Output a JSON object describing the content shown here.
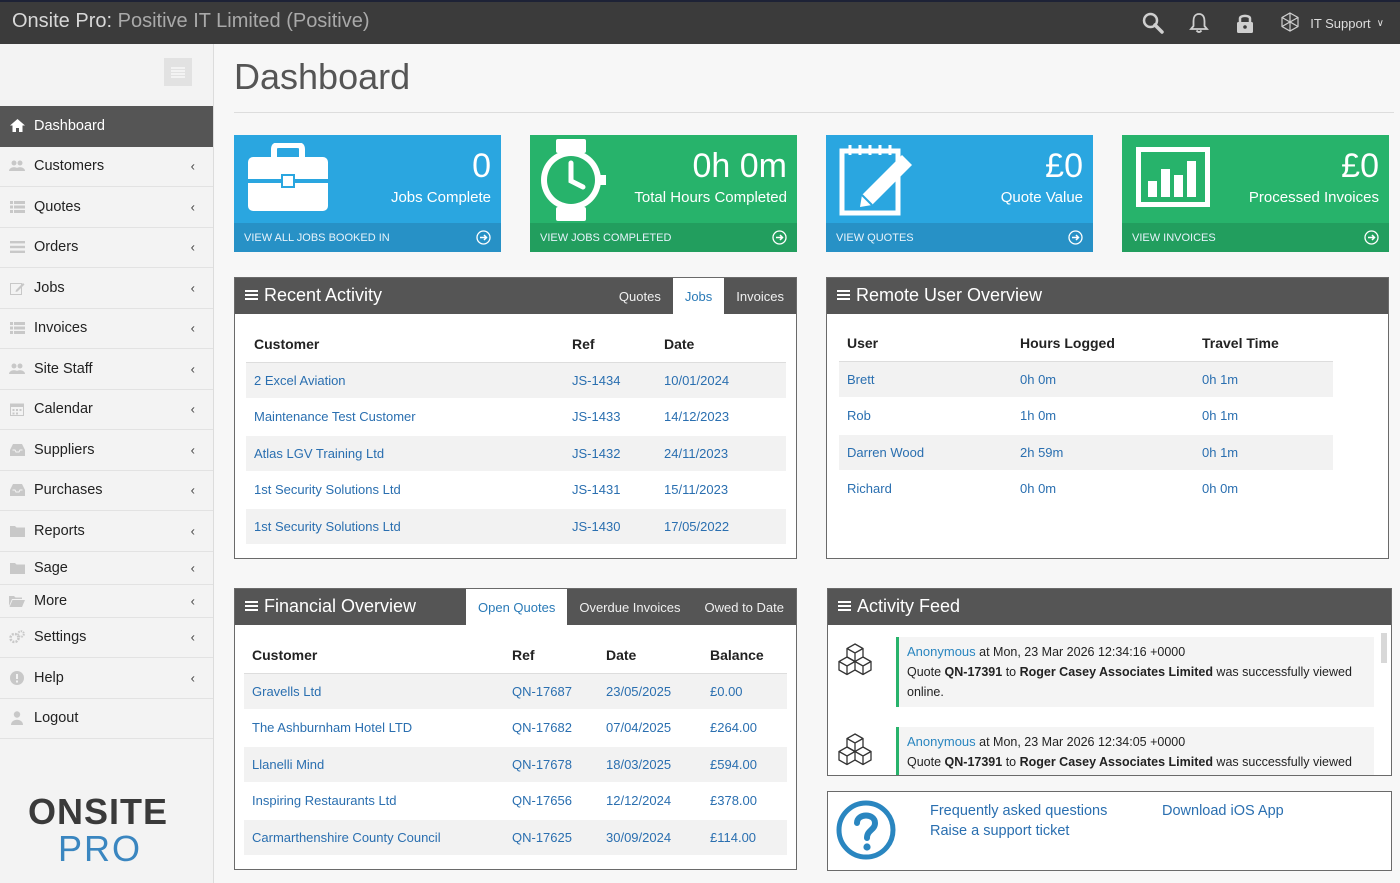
{
  "header": {
    "app_name": "Onsite Pro:",
    "company": " Positive IT Limited (Positive)",
    "user_label": "IT Support",
    "icons": [
      "search-icon",
      "bell-icon",
      "lock-icon",
      "user-avatar-icon"
    ]
  },
  "sidebar": {
    "items": [
      {
        "label": "Dashboard",
        "icon": "home-icon"
      },
      {
        "label": "Customers",
        "icon": "users-icon"
      },
      {
        "label": "Quotes",
        "icon": "list-icon"
      },
      {
        "label": "Orders",
        "icon": "list-icon"
      },
      {
        "label": "Jobs",
        "icon": "edit-icon"
      },
      {
        "label": "Invoices",
        "icon": "list-icon"
      },
      {
        "label": "Site Staff",
        "icon": "users-icon"
      },
      {
        "label": "Calendar",
        "icon": "calendar-icon"
      },
      {
        "label": "Suppliers",
        "icon": "inbox-icon"
      },
      {
        "label": "Purchases",
        "icon": "inbox-icon"
      },
      {
        "label": "Reports",
        "icon": "folder-icon"
      },
      {
        "label": "Sage",
        "icon": "folder-icon"
      },
      {
        "label": "More",
        "icon": "folder-open-icon"
      },
      {
        "label": "Settings",
        "icon": "cogs-icon"
      },
      {
        "label": "Help",
        "icon": "info-icon"
      },
      {
        "label": "Logout",
        "icon": "user-icon"
      }
    ],
    "chevron": "‹",
    "logo_top": "ONSITE",
    "logo_bottom": "PRO"
  },
  "page": {
    "title": "Dashboard"
  },
  "tiles": [
    {
      "value": "0",
      "label": "Jobs Complete",
      "footer": "VIEW ALL JOBS BOOKED IN",
      "color": "#2aa6e0",
      "icon": "briefcase-icon"
    },
    {
      "value": "0h 0m",
      "label": "Total Hours Completed",
      "footer": "VIEW JOBS COMPLETED",
      "color": "#27b36b",
      "icon": "clock-icon"
    },
    {
      "value": "£0",
      "label": "Quote Value",
      "footer": "VIEW QUOTES",
      "color": "#2aa6e0",
      "icon": "edit-icon"
    },
    {
      "value": "£0",
      "label": "Processed Invoices",
      "footer": "VIEW INVOICES",
      "color": "#27b36b",
      "icon": "bar-chart-icon"
    }
  ],
  "recent_activity": {
    "title": "Recent Activity",
    "tabs": [
      "Quotes",
      "Jobs",
      "Invoices"
    ],
    "active_tab": "Jobs",
    "columns": [
      "Customer",
      "Ref",
      "Date"
    ],
    "rows": [
      [
        "2 Excel Aviation",
        "JS-1434",
        "10/01/2024"
      ],
      [
        "Maintenance Test Customer",
        "JS-1433",
        "14/12/2023"
      ],
      [
        "Atlas LGV Training Ltd",
        "JS-1432",
        "24/11/2023"
      ],
      [
        "1st Security Solutions Ltd",
        "JS-1431",
        "15/11/2023"
      ],
      [
        "1st Security Solutions Ltd",
        "JS-1430",
        "17/05/2022"
      ]
    ]
  },
  "remote_users": {
    "title": "Remote User Overview",
    "columns": [
      "User",
      "Hours Logged",
      "Travel Time"
    ],
    "rows": [
      [
        "Brett",
        "0h 0m",
        "0h 1m"
      ],
      [
        "Rob",
        "1h 0m",
        "0h 1m"
      ],
      [
        "Darren Wood",
        "2h 59m",
        "0h 1m"
      ],
      [
        "Richard",
        "0h 0m",
        "0h 0m"
      ]
    ]
  },
  "financial": {
    "title": "Financial Overview",
    "tabs": [
      "Open Quotes",
      "Overdue Invoices",
      "Owed to Date"
    ],
    "active_tab": "Open Quotes",
    "columns": [
      "Customer",
      "Ref",
      "Date",
      "Balance"
    ],
    "rows": [
      [
        "Gravells Ltd",
        "QN-17687",
        "23/05/2025",
        "£0.00"
      ],
      [
        "The Ashburnham Hotel LTD",
        "QN-17682",
        "07/04/2025",
        "£264.00"
      ],
      [
        "Llanelli Mind",
        "QN-17678",
        "18/03/2025",
        "£594.00"
      ],
      [
        "Inspiring Restaurants Ltd",
        "QN-17656",
        "12/12/2024",
        "£378.00"
      ],
      [
        "Carmarthenshire County Council",
        "QN-17625",
        "30/09/2024",
        "£114.00"
      ]
    ]
  },
  "activity_feed": {
    "title": "Activity Feed",
    "items": [
      {
        "who": "Anonymous",
        "when": " at Mon, 23 Mar 2026 12:34:16 +0000",
        "pre": "Quote ",
        "ref": "QN-17391",
        "mid": " to ",
        "customer": "Roger Casey Associates Limited",
        "post": " was successfully viewed online."
      },
      {
        "who": "Anonymous",
        "when": " at Mon, 23 Mar 2026 12:34:05 +0000",
        "pre": "Quote ",
        "ref": "QN-17391",
        "mid": " to ",
        "customer": "Roger Casey Associates Limited",
        "post": " was successfully viewed"
      }
    ]
  },
  "help": {
    "faq": "Frequently asked questions",
    "ticket": "Raise a support ticket",
    "ios": "Download iOS App",
    "icon": "question-circle-icon"
  }
}
